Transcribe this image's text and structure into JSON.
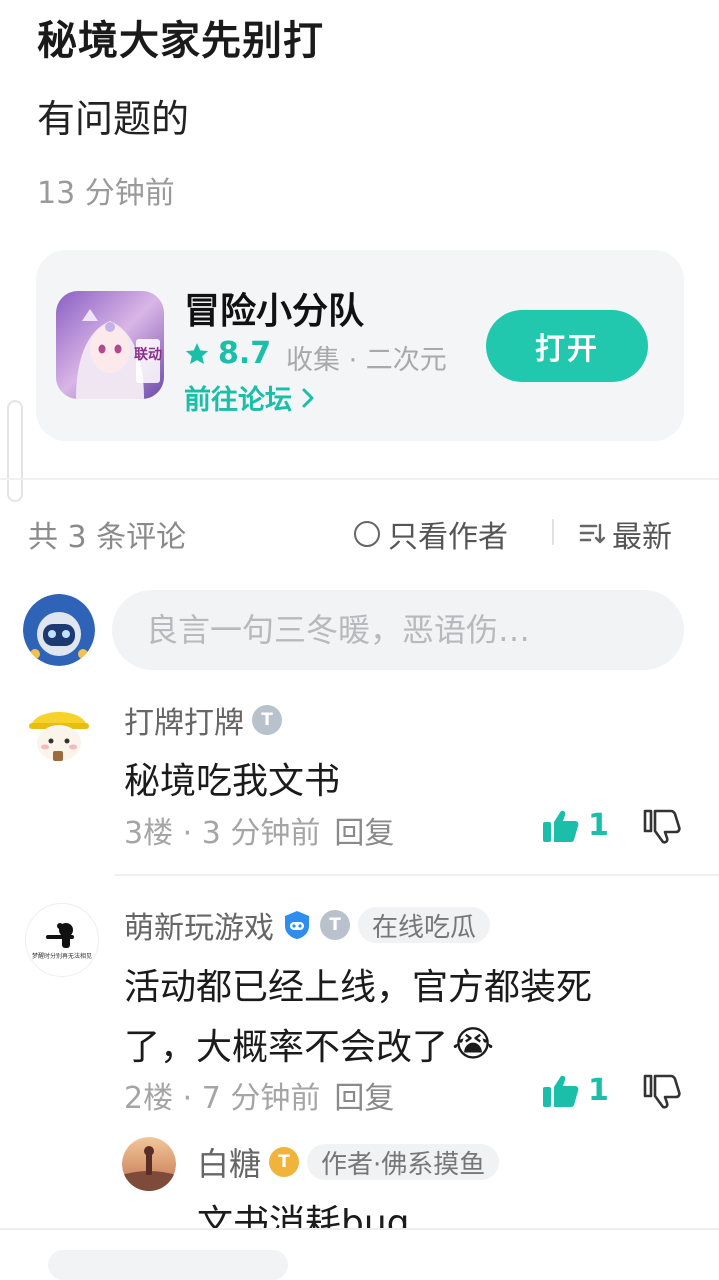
{
  "post": {
    "title": "秘境大家先别打",
    "body": "有问题的",
    "time": "13 分钟前"
  },
  "game": {
    "name": "冒险小分队",
    "score": "8.7",
    "meta": "收集 · 二次元",
    "forum_link": "前往论坛",
    "icon_badge": "联动",
    "open_button": "打开"
  },
  "comments_bar": {
    "count": "共 3 条评论",
    "only_author": "只看作者",
    "sort": "最新"
  },
  "composer": {
    "placeholder": "良言一句三冬暖，恶语伤…"
  },
  "comments": [
    {
      "name": "打牌打牌",
      "text": "秘境吃我文书",
      "floor": "3楼 · 3 分钟前",
      "reply": "回复",
      "likes": "1"
    },
    {
      "name": "萌新玩游戏",
      "tag": "在线吃瓜",
      "text_line1": "活动都已经上线，官方都装死",
      "text_line2": "了，大概率不会改了",
      "emoji": "😭",
      "avatar_caption": "梦醒时分别再无法相见",
      "floor": "2楼 · 7 分钟前",
      "reply": "回复",
      "likes": "1"
    }
  ],
  "sub_reply": {
    "name": "白糖",
    "tag": "作者·佛系摸鱼",
    "text": "文书消耗bug"
  },
  "colors": {
    "accent": "#22c8ad",
    "accent_text": "#1bbfa9",
    "card_bg": "#f3f5f6"
  }
}
